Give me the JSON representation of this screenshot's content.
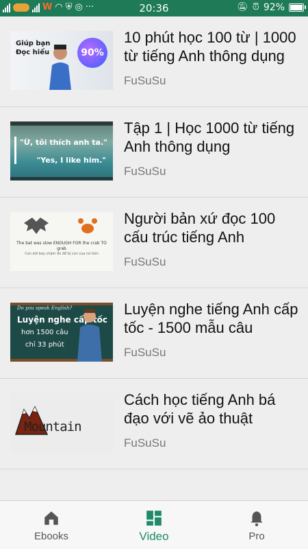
{
  "status_bar": {
    "time": "20:36",
    "battery": "92%",
    "battery_level": 0.92
  },
  "videos": [
    {
      "title": "10 phút học 100 từ | 1000 từ tiếng Anh thông dụng",
      "author": "FuSuSu",
      "thumb_text": [
        "Giúp bạn",
        "Đọc hiểu",
        "90%"
      ]
    },
    {
      "title": "Tập 1 | Học 1000 từ tiếng Anh thông dụng",
      "author": "FuSuSu",
      "thumb_text": [
        "\"Ừ, tôi thích anh ta.\"",
        "\"Yes, I like him.\""
      ]
    },
    {
      "title": "Người bản xứ đọc 100 cấu trúc tiếng Anh",
      "author": "FuSuSu",
      "thumb_text": [
        "The bat was slow ENOUGH FOR the crab TO grab",
        "Con dơi bay chậm đủ để bị con cua nó tóm"
      ]
    },
    {
      "title": "Luyện nghe tiếng Anh cấp tốc - 1500 mẫu câu",
      "author": "FuSuSu",
      "thumb_text": [
        "Do you speak English?",
        "Luyện nghe cấp tốc",
        "hơn 1500 câu",
        "chỉ 33 phút"
      ]
    },
    {
      "title": "Cách học tiếng Anh bá đạo với vẽ ảo thuật",
      "author": "FuSuSu",
      "thumb_text": [
        "Mountain"
      ]
    }
  ],
  "bottom_nav": {
    "items": [
      {
        "label": "Ebooks",
        "icon": "home-icon"
      },
      {
        "label": "Video",
        "icon": "dashboard-icon"
      },
      {
        "label": "Pro",
        "icon": "bell-icon"
      }
    ],
    "active_index": 1
  },
  "colors": {
    "status_bar": "#1e7a57",
    "accent": "#1e8a6a",
    "background": "#eeeeee"
  }
}
